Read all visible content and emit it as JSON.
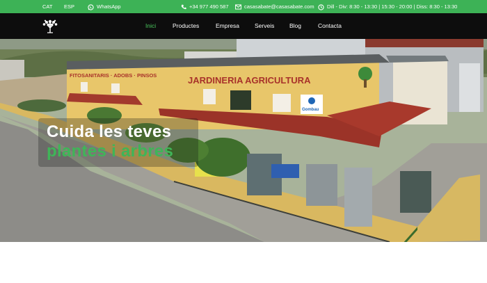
{
  "topbar": {
    "lang_cat": "CAT",
    "lang_esp": "ESP",
    "whatsapp": "WhatsApp",
    "phone": "+34 977 490 587",
    "email": "casasabate@casasabate.com",
    "hours": "Dill - Div: 8:30 - 13:30 | 15:30 - 20:00 | Diss: 8:30 - 13:30",
    "icons": [
      "whatsapp-icon",
      "phone-icon",
      "mail-icon",
      "clock-icon"
    ]
  },
  "nav": {
    "items": [
      {
        "label": "Inici",
        "active": true
      },
      {
        "label": "Productes",
        "active": false
      },
      {
        "label": "Empresa",
        "active": false
      },
      {
        "label": "Serveis",
        "active": false
      },
      {
        "label": "Blog",
        "active": false
      },
      {
        "label": "Contacta",
        "active": false
      }
    ]
  },
  "hero": {
    "title_line1": "Cuida les teves",
    "title_line2": "plantes i arbres",
    "sign_main": "JARDINERIA   AGRICULTURA",
    "sign_left": "FITOSANITARIS · ADOBS · PINSOS",
    "sign_brand": "Gombau"
  },
  "colors": {
    "accent": "#3db256",
    "topbar_bg": "#3db256",
    "navbar_bg": "#0d0d0d",
    "active_link": "#4bc85f",
    "building": "#e8c66a",
    "sign_text": "#a8322a"
  }
}
